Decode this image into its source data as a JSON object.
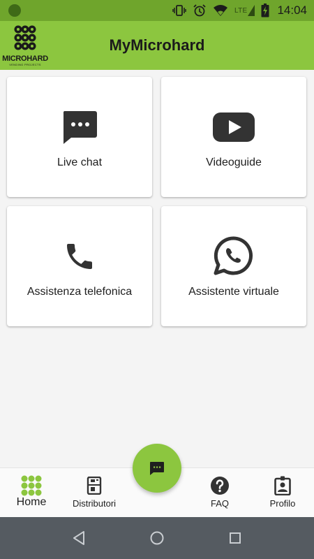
{
  "status_bar": {
    "network": "LTE",
    "time": "14:04"
  },
  "app_bar": {
    "title": "MyMicrohard",
    "logo_name": "MICROHARD",
    "logo_tagline": "VENDING PROJECTS"
  },
  "cards": [
    {
      "label": "Live chat",
      "icon": "chat-bubble-icon"
    },
    {
      "label": "Videoguide",
      "icon": "youtube-play-icon"
    },
    {
      "label": "Assistenza telefonica",
      "icon": "phone-icon"
    },
    {
      "label": "Assistente virtuale",
      "icon": "whatsapp-icon"
    }
  ],
  "bottom_nav": {
    "active": "Home",
    "items": [
      {
        "label": "Home",
        "icon": "home-dots-icon"
      },
      {
        "label": "Distributori",
        "icon": "vending-machine-icon"
      },
      {
        "label": "FAQ",
        "icon": "help-icon"
      },
      {
        "label": "Profilo",
        "icon": "profile-badge-icon"
      }
    ]
  },
  "fab": {
    "icon": "chat-icon"
  },
  "colors": {
    "status_bar": "#6fa52c",
    "app_bar": "#8cc63f",
    "accent": "#8cc63f",
    "icon_dark": "#333333",
    "system_nav": "#555b61"
  }
}
